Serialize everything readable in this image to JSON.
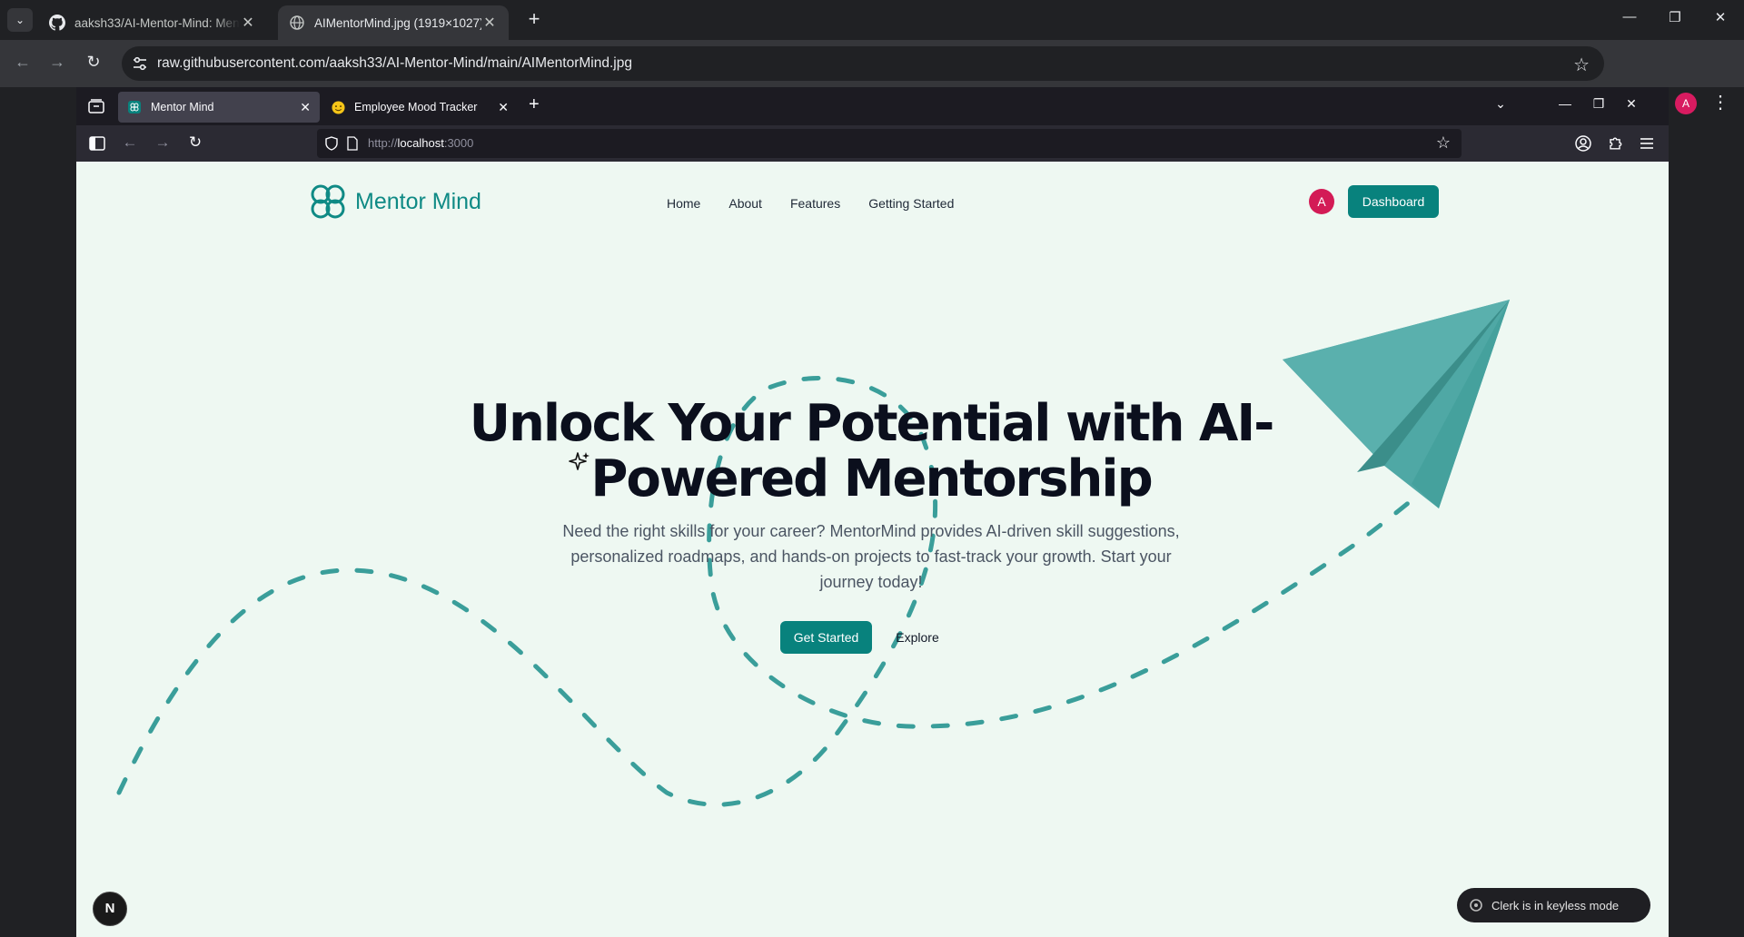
{
  "chrome": {
    "tabs": [
      {
        "title": "aaksh33/AI-Mentor-Mind: Mentor Mind",
        "icon": "github-icon"
      },
      {
        "title": "AIMentorMind.jpg (1919×1027)",
        "icon": "globe-icon"
      }
    ],
    "new_tab": "+",
    "url": "raw.githubusercontent.com/aaksh33/AI-Mentor-Mind/main/AIMentorMind.jpg",
    "profile_initial": "A"
  },
  "firefox": {
    "tabs": [
      {
        "title": "Mentor Mind",
        "icon": "mentor-mind-favicon"
      },
      {
        "title": "Employee Mood Tracker",
        "icon": "emoji-face-icon"
      }
    ],
    "url_prefix": "http://",
    "url_host": "localhost",
    "url_port": ":3000"
  },
  "site": {
    "brand": "Mentor Mind",
    "accent": "#08827d",
    "nav": [
      "Home",
      "About",
      "Features",
      "Getting Started"
    ],
    "avatar_initial": "A",
    "dashboard_label": "Dashboard",
    "hero_title": "Unlock Your Potential with AI-Powered Mentorship",
    "hero_subtitle": "Need the right skills for your career? MentorMind provides AI-driven skill suggestions, personalized roadmaps, and hands-on projects to fast-track your growth. Start your journey today!",
    "cta_primary": "Get Started",
    "cta_secondary": "Explore"
  },
  "dev": {
    "next_badge": "N",
    "clerk_toast": "Clerk is in keyless mode"
  }
}
